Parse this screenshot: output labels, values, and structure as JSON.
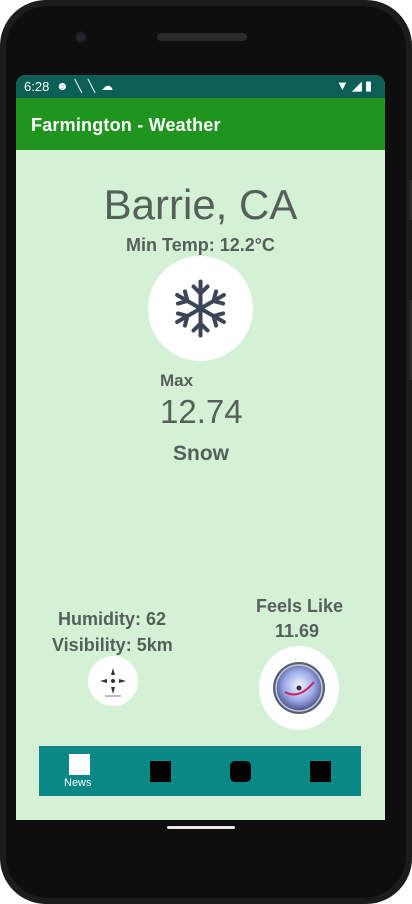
{
  "status_bar": {
    "time": "6:28",
    "left_icons": [
      "chat-icon",
      "signal-slash-icon",
      "signal-slash-icon",
      "cloud-icon"
    ],
    "right_icons": [
      "wifi-icon",
      "cell-signal-icon",
      "battery-icon"
    ]
  },
  "app_bar": {
    "title": "Farmington - Weather",
    "color": "#1f951f"
  },
  "weather": {
    "city": "Barrie, CA",
    "min_temp": "Min Temp: 12.2°C",
    "icon": "snowflake-icon",
    "max_label": "Max",
    "max_value": "12.74",
    "condition": "Snow",
    "humidity": "Humidity: 62",
    "visibility": "Visibility: 5km",
    "feels_like_label": "Feels Like",
    "feels_like_value": "11.69"
  },
  "bottom_nav": {
    "items": [
      {
        "label": "News",
        "icon": "news-icon"
      },
      {
        "label": "",
        "icon": "square-icon"
      },
      {
        "label": "",
        "icon": "rounded-square-icon"
      },
      {
        "label": "",
        "icon": "square-icon"
      }
    ],
    "color": "#0a8787"
  },
  "colors": {
    "background": "#d5f1d5",
    "text": "#55605a",
    "status_bar": "#0b5f55"
  }
}
